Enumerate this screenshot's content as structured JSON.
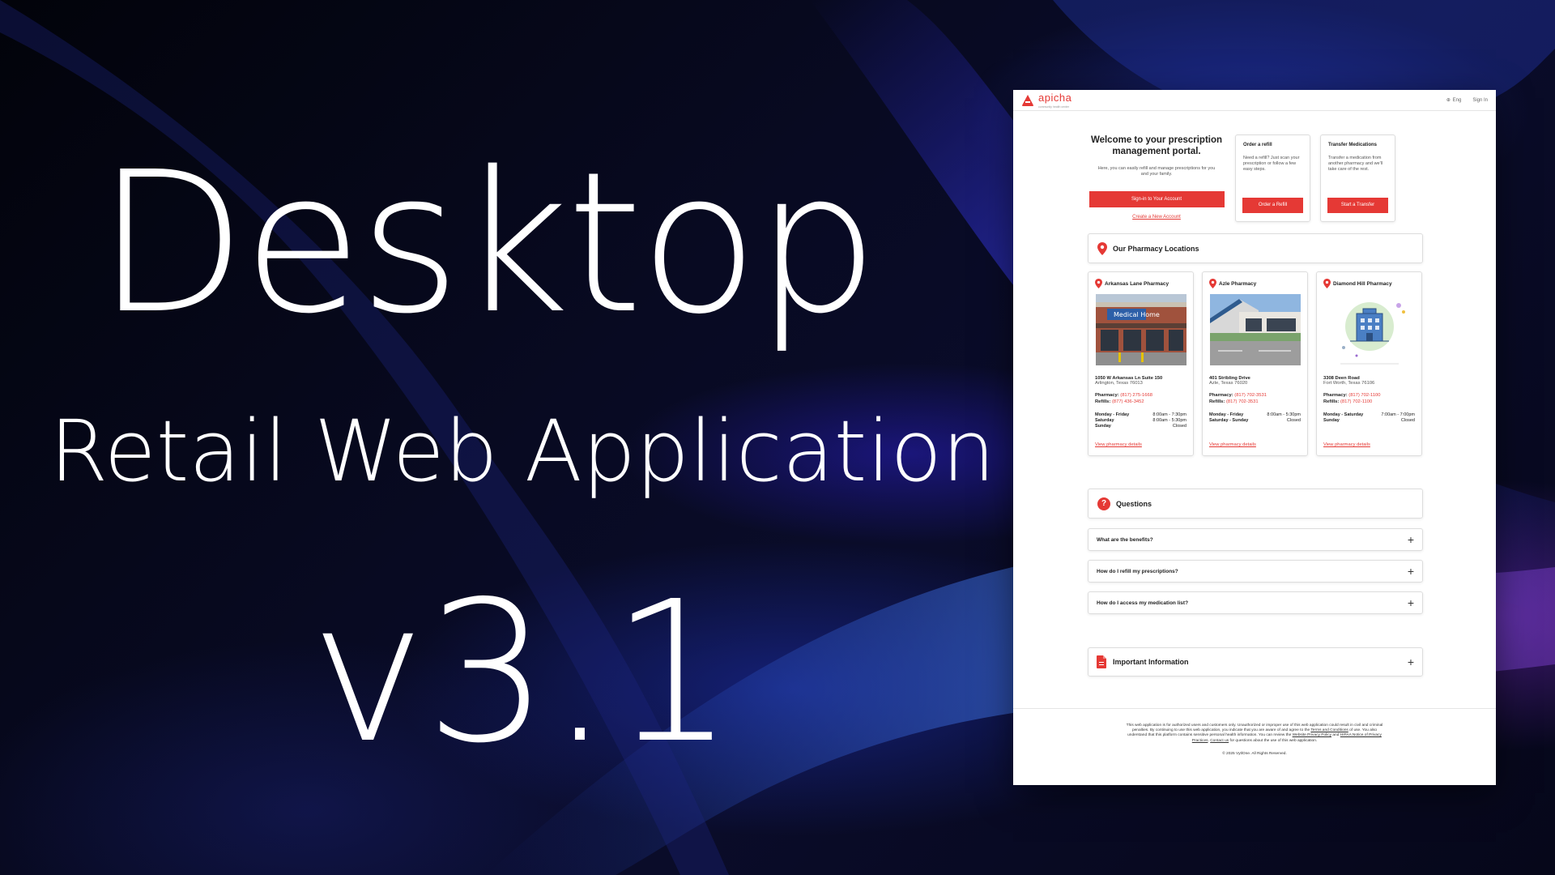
{
  "hero": {
    "title": "Desktop",
    "subtitle": "Retail Web Application",
    "version": "v3.1"
  },
  "portal": {
    "brand": {
      "name": "apicha",
      "tagline": "community health center"
    },
    "topbar": {
      "language": "Eng",
      "sign_in": "Sign In"
    },
    "welcome": {
      "title": "Welcome to your prescription management portal.",
      "text": "Here, you can easily refill and manage prescriptions for you and your family.",
      "signin_button": "Sign-in to Your Account",
      "create_link": "Create a New Account"
    },
    "cards": {
      "refill": {
        "title": "Order a refill",
        "text": "Need a refill? Just scan your prescription or follow a few easy steps.",
        "button": "Order a Refill"
      },
      "transfer": {
        "title": "Transfer Medications",
        "text": "Transfer a medication from another pharmacy and we'll take care of the rest.",
        "button": "Start a Transfer"
      }
    },
    "locations": {
      "heading": "Our Pharmacy Locations",
      "pharmacy_label": "Pharmacy:",
      "refills_label": "Refills:",
      "details_link": "View pharmacy details",
      "items": [
        {
          "name": "Arkansas Lane Pharmacy",
          "image_sign": "Medical Home",
          "address": "1050 W Arkansas Ln Suite 150",
          "city": "Arlington, Texas 76013",
          "pharmacy_phone": "(817) 275-1668",
          "refills_phone": "(877) 436-3452",
          "hours": [
            {
              "day": "Monday - Friday",
              "time": "8:00am - 7:30pm"
            },
            {
              "day": "Saturday",
              "time": "8:00am - 5:30pm"
            },
            {
              "day": "Sunday",
              "time": "Closed"
            }
          ]
        },
        {
          "name": "Azle Pharmacy",
          "address": "401 Stribling Drive",
          "city": "Azle, Texas 76020",
          "pharmacy_phone": "(817) 702-3531",
          "refills_phone": "(817) 702-3531",
          "hours": [
            {
              "day": "Monday - Friday",
              "time": "8:00am - 5:30pm"
            },
            {
              "day": "Saturday - Sunday",
              "time": "Closed"
            }
          ]
        },
        {
          "name": "Diamond Hill Pharmacy",
          "address": "3308 Deen Road",
          "city": "Fort Worth, Texas 76106",
          "pharmacy_phone": "(817) 702-1100",
          "refills_phone": "(817) 702-1100",
          "hours": [
            {
              "day": "Monday - Saturday",
              "time": "7:00am - 7:00pm"
            },
            {
              "day": "Sunday",
              "time": "Closed"
            }
          ]
        }
      ]
    },
    "questions": {
      "heading": "Questions",
      "items": [
        "What are the benefits?",
        "How do I refill my prescriptions?",
        "How do I access my medication list?"
      ]
    },
    "info": {
      "heading": "Important Information"
    },
    "footer": {
      "disclaimer_1": "This web application is for authorized users and customers only. Unauthorized or improper use of this web application could result in civil and criminal penalties. By continuing to use this web application, you indicate that you are aware of and agree to the",
      "terms_link": "Terms and Conditions",
      "disclaimer_2": "of use. You also understand that this platform contains sensitive personal health information. You can review the",
      "privacy_link": "Website Privacy Policy",
      "disclaimer_3": "and",
      "hipaa_link": "HIPAA Notice of Privacy Practices",
      "disclaimer_4": ".",
      "contact_link": "Contact us",
      "disclaimer_5": "for questions about the use of this web application.",
      "copyright": "© 2025 VytlOne. All Rights Reserved."
    },
    "colors": {
      "accent": "#e53935"
    }
  }
}
